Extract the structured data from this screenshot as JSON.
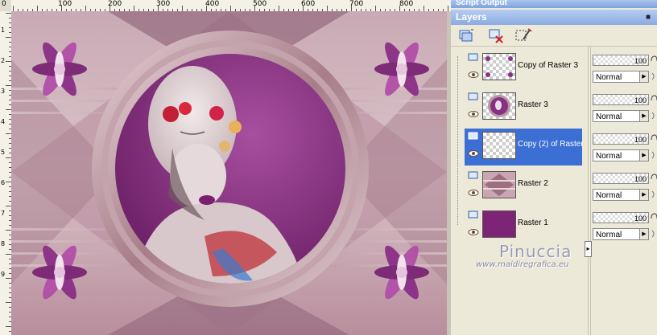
{
  "ruler": {
    "top_labels": [
      "0",
      "100",
      "200",
      "300",
      "400",
      "500",
      "600",
      "700",
      "800"
    ],
    "left_labels": [
      "0",
      "1",
      "2",
      "3",
      "4",
      "5",
      "6",
      "7",
      "8",
      "9"
    ]
  },
  "panels": {
    "script_output_title": "Script Output",
    "layers_title": "Layers",
    "pin_icon": "pin-icon"
  },
  "toolbar": {
    "icons": [
      "new-layer-icon",
      "delete-layer-icon",
      "edit-selection-icon"
    ]
  },
  "layers": [
    {
      "name": "Copy of Raster 3",
      "opacity": "100",
      "blend": "Normal",
      "thumb": "flowers-transparent"
    },
    {
      "name": "Raster 3",
      "opacity": "100",
      "blend": "Normal",
      "thumb": "portrait-circle"
    },
    {
      "name": "Copy (2) of Raster",
      "opacity": "100",
      "blend": "Normal",
      "thumb": "transparent",
      "selected": true
    },
    {
      "name": "Raster 2",
      "opacity": "100",
      "blend": "Normal",
      "thumb": "pattern-pink"
    },
    {
      "name": "Raster 1",
      "opacity": "100",
      "blend": "Normal",
      "thumb": "solid-purple"
    }
  ],
  "watermark": {
    "name": "Pinuccia",
    "url": "www.maidiregrafica.eu"
  },
  "colors": {
    "selection": "#3b6fd3",
    "purple": "#8a2f86",
    "panel_bg": "#ece9d8"
  }
}
